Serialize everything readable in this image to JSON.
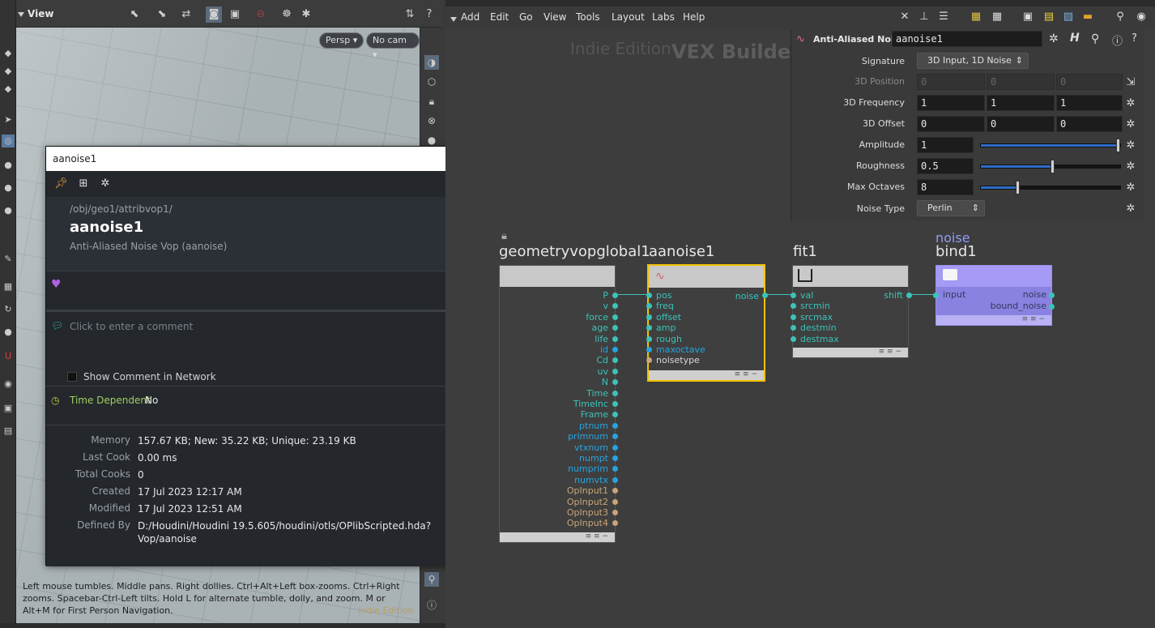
{
  "viewport": {
    "title": "View",
    "persp": "Persp",
    "cam": "No cam",
    "help": "Left mouse tumbles. Middle pans. Right dollies. Ctrl+Alt+Left box-zooms. Ctrl+Right zooms. Spacebar-Ctrl-Left tilts. Hold L for alternate tumble, dolly, and zoom.     M or Alt+M for First Person Navigation.",
    "watermark": "Indie Edition"
  },
  "info": {
    "window_title": "aanoise1",
    "close": "x",
    "path": "/obj/geo1/attribvop1/",
    "name": "aanoise1",
    "type": "Anti-Aliased Noise Vop (aanoise)",
    "comment_placeholder": "Click to enter a comment",
    "show_comment": "Show Comment in Network",
    "time_dependent_label": "Time Dependent",
    "time_dependent_value": "No",
    "stats": [
      {
        "label": "Memory",
        "value": "157.67 KB; New: 35.22 KB; Unique: 23.19 KB"
      },
      {
        "label": "Last Cook",
        "value": "0.00 ms"
      },
      {
        "label": "Total Cooks",
        "value": "0"
      },
      {
        "label": "Created",
        "value": "17 Jul 2023 12:17 AM"
      },
      {
        "label": "Modified",
        "value": "17 Jul 2023 12:51 AM"
      },
      {
        "label": "Defined By",
        "value": "D:/Houdini/Houdini 19.5.605/houdini/otls/OPlibScripted.hda?Vop/aanoise"
      }
    ]
  },
  "network": {
    "menu": [
      "Add",
      "Edit",
      "Go",
      "View",
      "Tools",
      "Layout",
      "Labs",
      "Help"
    ],
    "watermark_edition": "Indie Edition",
    "watermark_context": "VEX Builder"
  },
  "params": {
    "node_type": "Anti-Aliased Noise",
    "node_name": "aanoise1",
    "signature_label": "Signature",
    "signature_value": "3D Input, 1D Noise",
    "position_label": "3D Position",
    "position": [
      "0",
      "0",
      "0"
    ],
    "frequency_label": "3D Frequency",
    "frequency": [
      "1",
      "1",
      "1"
    ],
    "offset_label": "3D Offset",
    "offset": [
      "0",
      "0",
      "0"
    ],
    "amplitude_label": "Amplitude",
    "amplitude": "1",
    "amplitude_level": 1.0,
    "roughness_label": "Roughness",
    "roughness": "0.5",
    "roughness_level": 0.5,
    "octaves_label": "Max Octaves",
    "octaves": "8",
    "octaves_level": 0.25,
    "noise_type_label": "Noise Type",
    "noise_type": "Perlin"
  },
  "nodes": {
    "global": {
      "name": "geometryvopglobal1",
      "outputs": [
        "P",
        "v",
        "force",
        "age",
        "life",
        "id",
        "Cd",
        "uv",
        "N",
        "Time",
        "TimeInc",
        "Frame",
        "ptnum",
        "primnum",
        "vtxnum",
        "numpt",
        "numprim",
        "numvtx",
        "OpInput1",
        "OpInput2",
        "OpInput3",
        "OpInput4"
      ]
    },
    "aanoise": {
      "name": "aanoise1",
      "inputs": [
        "pos",
        "freq",
        "offset",
        "amp",
        "rough",
        "maxoctave",
        "noisetype"
      ],
      "output": "noise"
    },
    "fit": {
      "name": "fit1",
      "inputs": [
        "val",
        "srcmin",
        "srcmax",
        "destmin",
        "destmax"
      ],
      "output": "shift"
    },
    "bind": {
      "label": "noise",
      "name": "bind1",
      "input": "input",
      "outputs": [
        "noise",
        "bound_noise"
      ]
    }
  },
  "colors": {
    "selected_border": "#f2c200",
    "bind_header": "#a59af5",
    "port_vector": "#3cc3b9",
    "port_int": "#27a4e0",
    "port_string": "#c8a478",
    "wire": "#3cc3b9"
  }
}
